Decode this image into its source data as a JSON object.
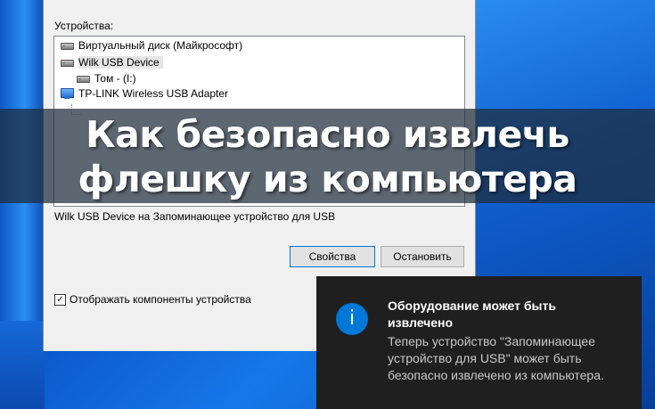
{
  "dialog": {
    "devices_label": "Устройства:",
    "devices": [
      {
        "label": "Виртуальный диск (Майкрософт)",
        "icon": "disk-drive-icon"
      },
      {
        "label": "Wilk USB Device",
        "icon": "usb-drive-icon",
        "selected": true
      },
      {
        "label": "Том - (I:)",
        "icon": "volume-icon",
        "child": true
      },
      {
        "label": "TP-LINK Wireless USB Adapter",
        "icon": "network-adapter-icon"
      }
    ],
    "status_text": "Wilk USB Device на Запоминающее устройство для USB",
    "properties_button": "Свойства",
    "stop_button": "Остановить",
    "show_components_label": "Отображать компоненты устройства",
    "show_components_checked": true
  },
  "banner": {
    "title": "Как безопасно извлечь флешку из компьютера"
  },
  "toast": {
    "icon": "info-icon",
    "icon_glyph": "i",
    "title": "Оборудование может быть извлечено",
    "body": "Теперь устройство \"Запоминающее устройство для USB\" может быть безопасно извлечено из компьютера.",
    "accent_color": "#0078d7"
  }
}
